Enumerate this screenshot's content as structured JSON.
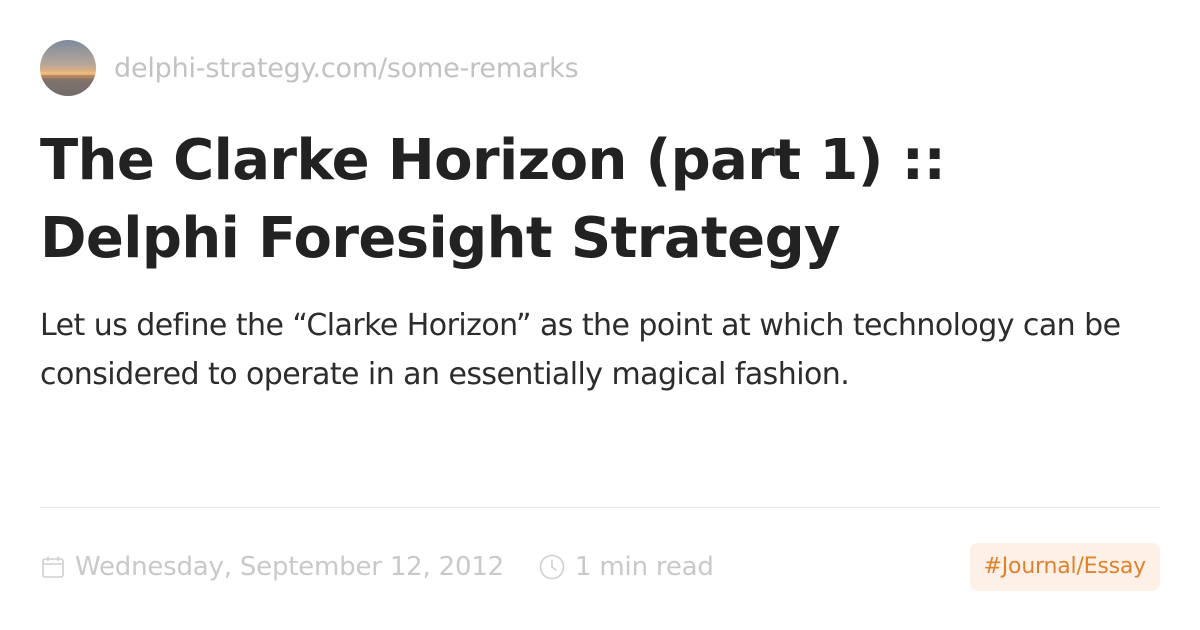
{
  "site": {
    "url": "delphi-strategy.com/some-remarks",
    "avatar_icon": "landscape-sunset-avatar"
  },
  "article": {
    "title_line1": "The Clarke Horizon (part 1) ::",
    "title_line2": "Delphi Foresight Strategy",
    "description": "Let us define the “Clarke Horizon” as the point at which technology can be considered to operate in an essentially magical fashion."
  },
  "meta": {
    "date": "Wednesday, September 12, 2012",
    "date_icon": "calendar-icon",
    "read_time": "1 min read",
    "read_icon": "clock-icon",
    "tag": "#Journal/Essay"
  },
  "colors": {
    "title": "#222222",
    "muted": "#c9c9c9",
    "tag_text": "#e0822c",
    "tag_bg": "#fdf1e7",
    "divider": "#e9e9e9"
  }
}
